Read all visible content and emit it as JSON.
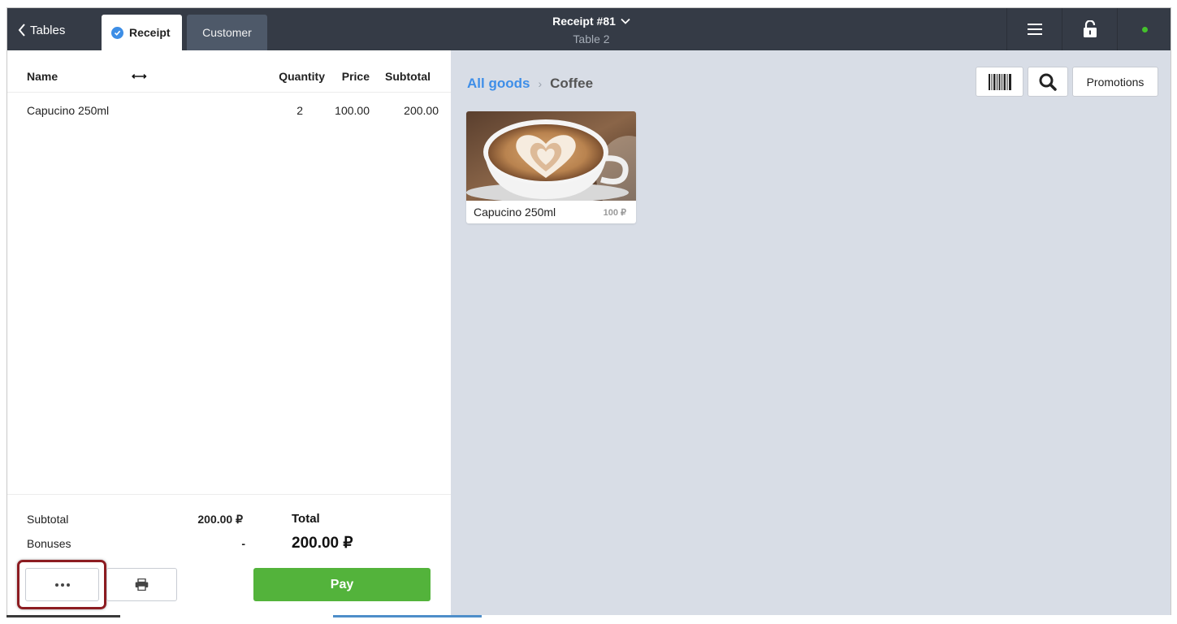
{
  "topbar": {
    "back_label": "Tables",
    "tabs": [
      {
        "label": "Receipt",
        "active": true
      },
      {
        "label": "Customer",
        "active": false
      }
    ],
    "title": "Receipt #81",
    "subtitle": "Table 2",
    "icons": [
      "menu-icon",
      "unlock-icon",
      "online-status-dot"
    ],
    "status_color": "#44c12c"
  },
  "receipt": {
    "columns": {
      "name": "Name",
      "quantity": "Quantity",
      "price": "Price",
      "subtotal": "Subtotal"
    },
    "items": [
      {
        "name": "Capucino 250ml",
        "quantity": "2",
        "price": "100.00",
        "subtotal": "200.00"
      }
    ],
    "summary": {
      "subtotal_label": "Subtotal",
      "subtotal_value": "200.00 ₽",
      "bonuses_label": "Bonuses",
      "bonuses_value": "-",
      "total_label": "Total",
      "total_value": "200.00 ₽"
    },
    "actions": {
      "more_icon": "more-dots-icon",
      "print_icon": "printer-icon",
      "pay_label": "Pay",
      "pay_color": "#53b33b"
    }
  },
  "goods": {
    "breadcrumb": {
      "root": "All goods",
      "current": "Coffee"
    },
    "toolbar": {
      "barcode_icon": "barcode-icon",
      "search_icon": "search-icon",
      "promotions_label": "Promotions"
    },
    "products": [
      {
        "name": "Capucino 250ml",
        "price": "100 ₽"
      }
    ]
  },
  "colors": {
    "topbar": "#353b46",
    "accent": "#3e8ee8",
    "goods_bg": "#d8dde6"
  }
}
